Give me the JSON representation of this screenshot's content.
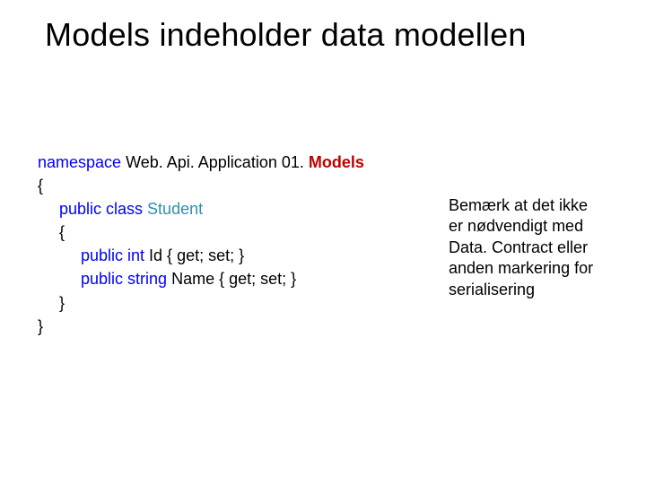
{
  "title": "Models indeholder data modellen",
  "code": {
    "l1_kw": "namespace",
    "l1_ns": " Web. Api. Application 01. ",
    "l1_models": "Models",
    "l2": "{",
    "l3_kw1": "public",
    "l3_kw2": " class ",
    "l3_type": "Student",
    "l4": "{",
    "l5_kw1": "public",
    "l5_kw2": " int",
    "l5_rest": " Id { get; set; }",
    "l6_kw1": "public",
    "l6_kw2": " string",
    "l6_rest": " Name { get; set; }",
    "l7": "}",
    "l8": "}"
  },
  "note": {
    "l1": "Bemærk at det ikke",
    "l2": "er nødvendigt med",
    "l3": "Data. Contract eller",
    "l4": "anden markering for",
    "l5": "serialisering"
  }
}
